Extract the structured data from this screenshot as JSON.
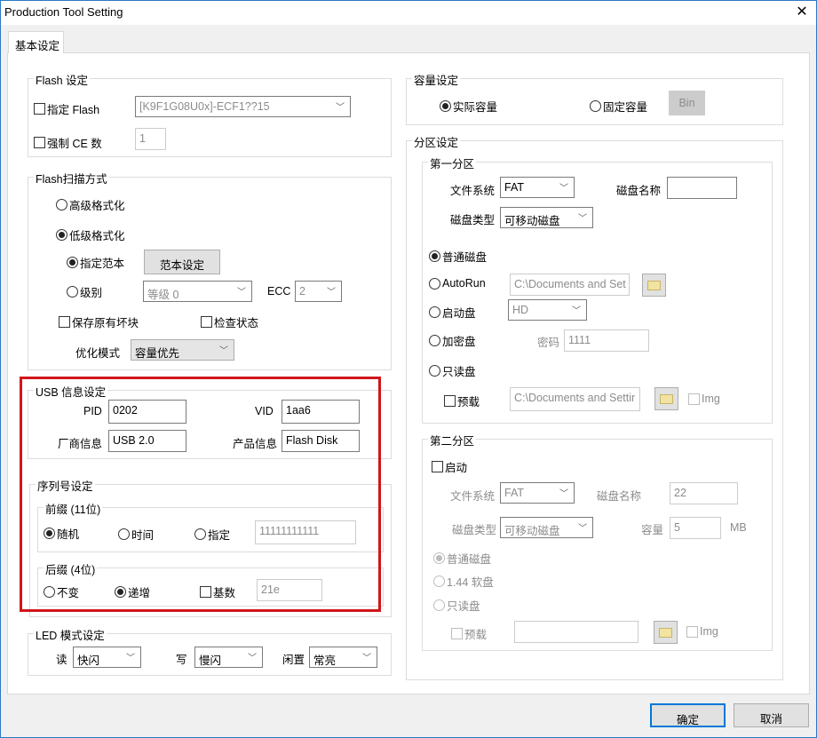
{
  "window": {
    "title": "Production Tool Setting",
    "close": "✕"
  },
  "tab": "基本设定",
  "flash": {
    "title": "Flash 设定",
    "specify_flash": "指定 Flash",
    "flash_model": "[K9F1G08U0x]-ECF1??15",
    "force_ce": "强制 CE 数",
    "ce_value": "1"
  },
  "scan": {
    "title": "Flash扫描方式",
    "high_format": "高级格式化",
    "low_format": "低级格式化",
    "specify_template": "指定范本",
    "template_button": "范本设定",
    "level": "级别",
    "level_value": "等级 0",
    "ecc_label": "ECC",
    "ecc_value": "2",
    "keep_bad_blocks": "保存原有坏块",
    "check_status": "检查状态",
    "optimize_label": "优化模式",
    "optimize_value": "容量优先"
  },
  "usb": {
    "title": "USB 信息设定",
    "pid_label": "PID",
    "pid": "0202",
    "vid_label": "VID",
    "vid": "1aa6",
    "vendor_label": "厂商信息",
    "vendor": "USB 2.0",
    "product_label": "产品信息",
    "product": "Flash Disk"
  },
  "serial": {
    "title": "序列号设定",
    "prefix_title": "前缀 (11位)",
    "random": "随机",
    "time": "时间",
    "specify": "指定",
    "prefix_value": "11111111111",
    "suffix_title": "后缀 (4位)",
    "unchanged": "不变",
    "increment": "递增",
    "base": "基数",
    "base_value": "21e"
  },
  "led": {
    "title": "LED 模式设定",
    "read_label": "读",
    "read": "快闪",
    "write_label": "写",
    "write": "慢闪",
    "idle_label": "闲置",
    "idle": "常亮"
  },
  "capacity": {
    "title": "容量设定",
    "actual": "实际容量",
    "fixed": "固定容量",
    "bin": "Bin"
  },
  "partition": {
    "title": "分区设定",
    "first": {
      "title": "第一分区",
      "fs_label": "文件系统",
      "fs": "FAT",
      "name_label": "磁盘名称",
      "name": "",
      "type_label": "磁盘类型",
      "type": "可移动磁盘",
      "normal": "普通磁盘",
      "autorun": "AutoRun",
      "autorun_path": "C:\\Documents and Set",
      "boot": "启动盘",
      "boot_value": "HD",
      "encrypt": "加密盘",
      "password_label": "密码",
      "password": "1111",
      "readonly": "只读盘",
      "preload": "预载",
      "preload_path": "C:\\Documents and Settir",
      "img": "Img"
    },
    "second": {
      "title": "第二分区",
      "enable": "启动",
      "fs_label": "文件系统",
      "fs": "FAT",
      "name_label": "磁盘名称",
      "name": "22",
      "type_label": "磁盘类型",
      "type": "可移动磁盘",
      "cap_label": "容量",
      "cap": "5",
      "unit": "MB",
      "normal": "普通磁盘",
      "floppy": "1.44 软盘",
      "readonly": "只读盘",
      "preload": "预载",
      "preload_path": "",
      "img": "Img"
    }
  },
  "buttons": {
    "ok": "确定",
    "cancel": "取消"
  },
  "colors": {
    "highlight": "#d0161b",
    "window_border": "#2b79c7"
  }
}
